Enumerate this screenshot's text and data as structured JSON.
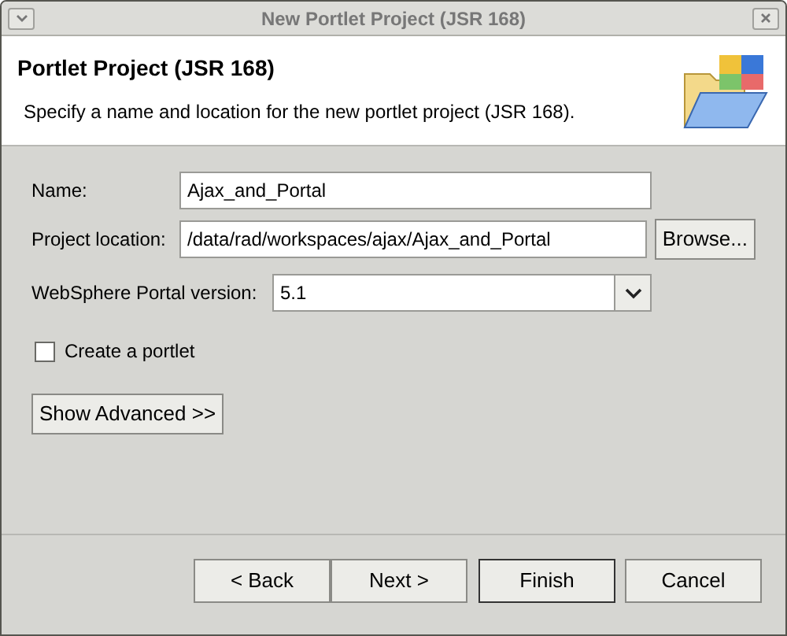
{
  "window": {
    "title": "New Portlet Project (JSR 168)"
  },
  "header": {
    "title": "Portlet Project (JSR 168)",
    "description": "Specify a name and location for the new portlet project (JSR 168)."
  },
  "fields": [
    {
      "label": "Name:",
      "value": "Ajax_and_Portal"
    },
    {
      "label": "Project location:",
      "value": "/data/rad/workspaces/ajax/Ajax_and_Portal",
      "button": "Browse..."
    }
  ],
  "version": {
    "label": "WebSphere Portal version:",
    "value": "5.1"
  },
  "create_portlet": {
    "label": "Create a portlet",
    "checked": false
  },
  "advanced_button": "Show Advanced >>",
  "buttons": [
    {
      "label": "< Back",
      "default": false
    },
    {
      "label": "Next >",
      "default": false
    },
    {
      "label": "Finish",
      "default": true
    },
    {
      "label": "Cancel",
      "default": false
    }
  ]
}
